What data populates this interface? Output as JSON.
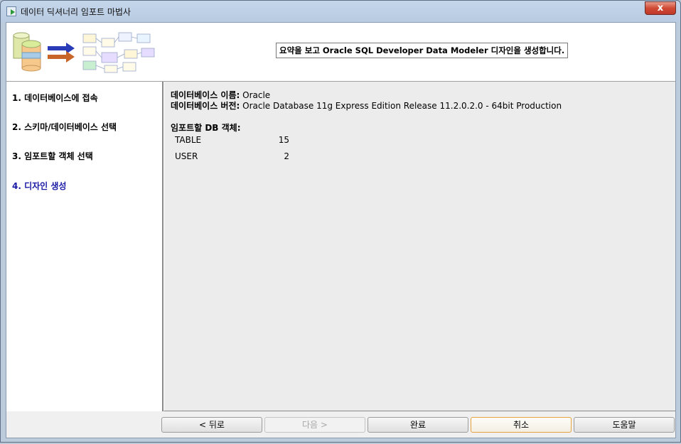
{
  "window": {
    "title": "데이터 딕셔너리 임포트 마법사",
    "close_label": "x"
  },
  "header": {
    "message": "요약을 보고 Oracle SQL Developer Data Modeler 디자인을 생성합니다."
  },
  "steps": [
    {
      "label": "1. 데이터베이스에 접속",
      "active": false
    },
    {
      "label": "2. 스키마/데이터베이스 선택",
      "active": false
    },
    {
      "label": "3. 임포트할 객체 선택",
      "active": false
    },
    {
      "label": "4. 디자인 생성",
      "active": true
    }
  ],
  "summary": {
    "db_name_label": "데이터베이스 이름:",
    "db_name_value": "Oracle",
    "db_version_label": "데이터베이스 버전:",
    "db_version_value": "Oracle Database 11g Express Edition Release 11.2.0.2.0 - 64bit Production",
    "objects_heading": "임포트할 DB 객체:",
    "objects": [
      {
        "name": "TABLE",
        "count": "15"
      },
      {
        "name": "USER",
        "count": "2"
      }
    ]
  },
  "buttons": {
    "back": "< 뒤로",
    "next": "다음 >",
    "finish": "완료",
    "cancel": "취소",
    "help": "도움말"
  },
  "colors": {
    "active_step": "#1a1aa6",
    "close_button": "#c0392b",
    "focus_border": "#e6a23c"
  }
}
